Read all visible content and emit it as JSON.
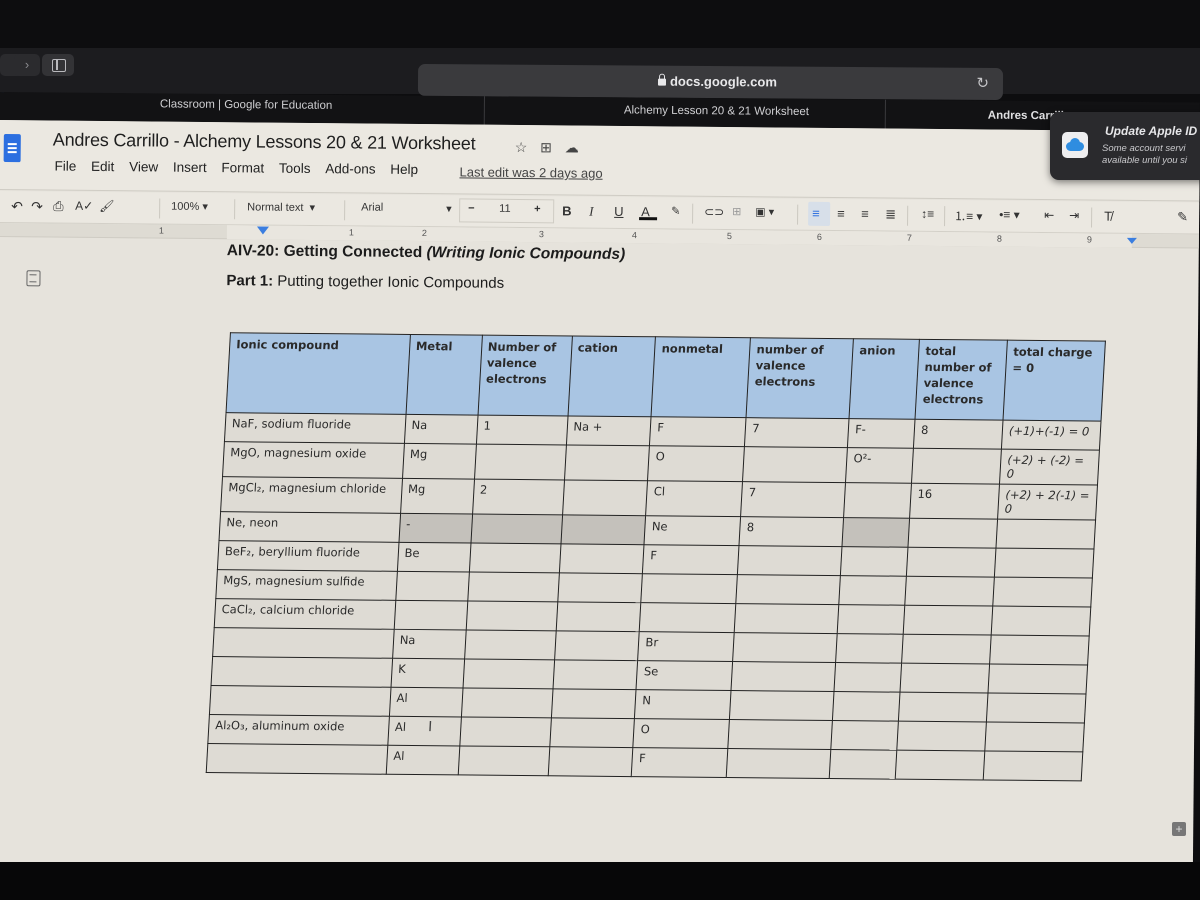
{
  "browser": {
    "url": "docs.google.com",
    "tabs": [
      {
        "label": "Classroom | Google for Education"
      },
      {
        "label": "Alchemy Lesson 20 & 21 Worksheet"
      },
      {
        "label": "Andres Carrill"
      }
    ]
  },
  "notification": {
    "title": "Update Apple ID S",
    "body_line1": "Some account servi",
    "body_line2": "available until you si"
  },
  "docs": {
    "title": "Andres Carrillo - Alchemy Lessons 20 & 21 Worksheet",
    "menu": [
      "File",
      "Edit",
      "View",
      "Insert",
      "Format",
      "Tools",
      "Add-ons",
      "Help"
    ],
    "last_edit": "Last edit was 2 days ago",
    "toolbar": {
      "zoom": "100%",
      "style": "Normal text",
      "font": "Arial",
      "font_size": "11",
      "bold": "B",
      "italic": "I",
      "underline": "U",
      "text_color": "A"
    },
    "ruler": [
      "1",
      "1",
      "2",
      "3",
      "4",
      "5",
      "6",
      "7",
      "8",
      "9"
    ]
  },
  "document": {
    "heading_main": "AIV-20: Getting Connected ",
    "heading_italic": "(Writing Ionic Compounds)",
    "part_label": "Part 1:",
    "part_text": " Putting together Ionic Compounds"
  },
  "table": {
    "headers": [
      "Ionic compound",
      "Metal",
      "Number of valence electrons",
      "cation",
      "nonmetal",
      "number of valence electrons",
      "anion",
      "total number of valence electrons",
      "total charge = 0"
    ],
    "rows": [
      [
        "NaF, sodium fluoride",
        "Na",
        "1",
        "Na +",
        "F",
        "7",
        "F-",
        "8",
        "(+1)+(-1) = 0"
      ],
      [
        "MgO, magnesium oxide",
        "Mg",
        "",
        "",
        "O",
        "",
        "O²-",
        "",
        "(+2) + (-2) = 0"
      ],
      [
        "MgCl₂, magnesium chloride",
        "Mg",
        "2",
        "",
        "Cl",
        "7",
        "",
        "16",
        "(+2) + 2(-1) = 0"
      ],
      [
        "Ne, neon",
        "-",
        "",
        "",
        "Ne",
        "8",
        "",
        "",
        ""
      ],
      [
        "BeF₂, beryllium fluoride",
        "Be",
        "",
        "",
        "F",
        "",
        "",
        "",
        ""
      ],
      [
        "MgS, magnesium sulfide",
        "",
        "",
        "",
        "",
        "",
        "",
        "",
        ""
      ],
      [
        "CaCl₂, calcium chloride",
        "",
        "",
        "",
        "",
        "",
        "",
        "",
        ""
      ],
      [
        "",
        "Na",
        "",
        "",
        "Br",
        "",
        "",
        "",
        ""
      ],
      [
        "",
        "K",
        "",
        "",
        "Se",
        "",
        "",
        "",
        ""
      ],
      [
        "",
        "Al",
        "",
        "",
        "N",
        "",
        "",
        "",
        ""
      ],
      [
        "Al₂O₃, aluminum oxide",
        "Al",
        "",
        "",
        "O",
        "",
        "",
        "",
        ""
      ],
      [
        "",
        "Al",
        "",
        "",
        "F",
        "",
        "",
        "",
        ""
      ]
    ]
  },
  "colors": {
    "header_fill": "#a9c5e3",
    "docs_blue": "#2c6fe0",
    "shaded_cell": "#c4c1bb"
  }
}
